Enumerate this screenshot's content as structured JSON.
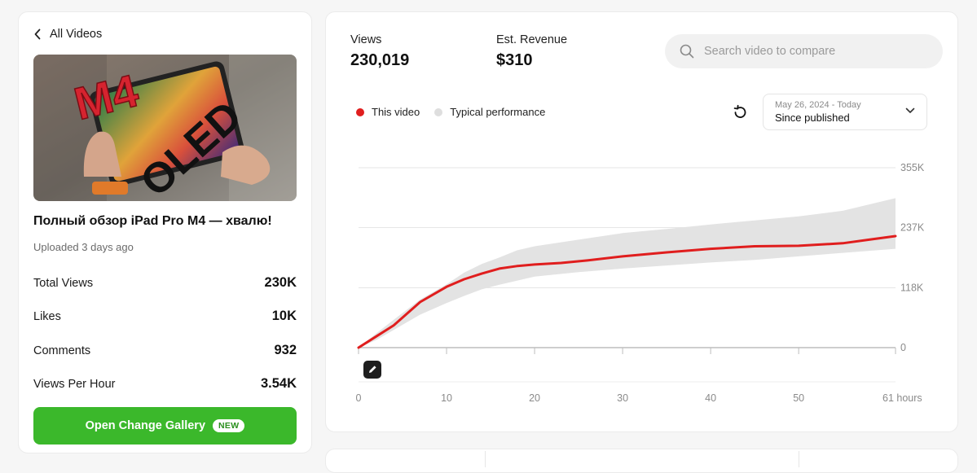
{
  "left": {
    "back_label": "All Videos",
    "video_title": "Полный обзор iPad Pro M4 — хвалю!",
    "uploaded": "Uploaded 3 days ago",
    "thumbnail_text": [
      "M4",
      "OLED"
    ],
    "stats": [
      {
        "label": "Total Views",
        "value": "230K"
      },
      {
        "label": "Likes",
        "value": "10K"
      },
      {
        "label": "Comments",
        "value": "932"
      },
      {
        "label": "Views Per Hour",
        "value": "3.54K"
      }
    ],
    "gallery_button": "Open Change Gallery",
    "new_badge": "NEW"
  },
  "metrics": {
    "views_label": "Views",
    "views_value": "230,019",
    "revenue_label": "Est. Revenue",
    "revenue_value": "$310"
  },
  "search": {
    "placeholder": "Search video to compare"
  },
  "legend": {
    "this_video": "This video",
    "typical": "Typical performance"
  },
  "date_select": {
    "range": "May 26, 2024 - Today",
    "value": "Since published"
  },
  "colors": {
    "this_video": "#e01e1e",
    "typical": "#e3e3e3",
    "accent": "#3bb82b"
  },
  "chart_data": {
    "type": "area",
    "x_unit": "hours",
    "x_ticks": [
      "0",
      "10",
      "20",
      "30",
      "40",
      "50",
      "61 hours"
    ],
    "x_tick_values": [
      0,
      10,
      20,
      30,
      40,
      50,
      61
    ],
    "y_ticks": [
      "0",
      "118K",
      "237K",
      "355K"
    ],
    "y_tick_values": [
      0,
      118000,
      237000,
      355000
    ],
    "xlim": [
      0,
      61
    ],
    "ylim": [
      0,
      355000
    ],
    "grid": true,
    "legend": "top-left",
    "series": [
      {
        "name": "This video",
        "x": [
          0,
          2,
          4,
          7,
          10,
          12,
          14,
          16,
          18,
          20,
          23,
          26,
          30,
          35,
          40,
          45,
          50,
          55,
          58,
          61
        ],
        "y": [
          0,
          22000,
          44000,
          90000,
          120000,
          135000,
          146000,
          156000,
          161000,
          164000,
          167000,
          172000,
          180000,
          188000,
          195000,
          200000,
          201000,
          206000,
          213000,
          220000
        ]
      },
      {
        "name": "Typical performance",
        "x": [
          0,
          2,
          4,
          7,
          10,
          12,
          14,
          16,
          18,
          20,
          25,
          30,
          35,
          40,
          45,
          50,
          55,
          61
        ],
        "y_upper": [
          0,
          28000,
          55000,
          95000,
          125000,
          148000,
          165000,
          178000,
          192000,
          200000,
          213000,
          226000,
          234000,
          243000,
          251000,
          259000,
          270000,
          295000
        ],
        "y_lower": [
          0,
          15000,
          35000,
          65000,
          88000,
          102000,
          115000,
          124000,
          132000,
          140000,
          149000,
          156000,
          162000,
          168000,
          173000,
          180000,
          187000,
          195000
        ]
      }
    ]
  }
}
